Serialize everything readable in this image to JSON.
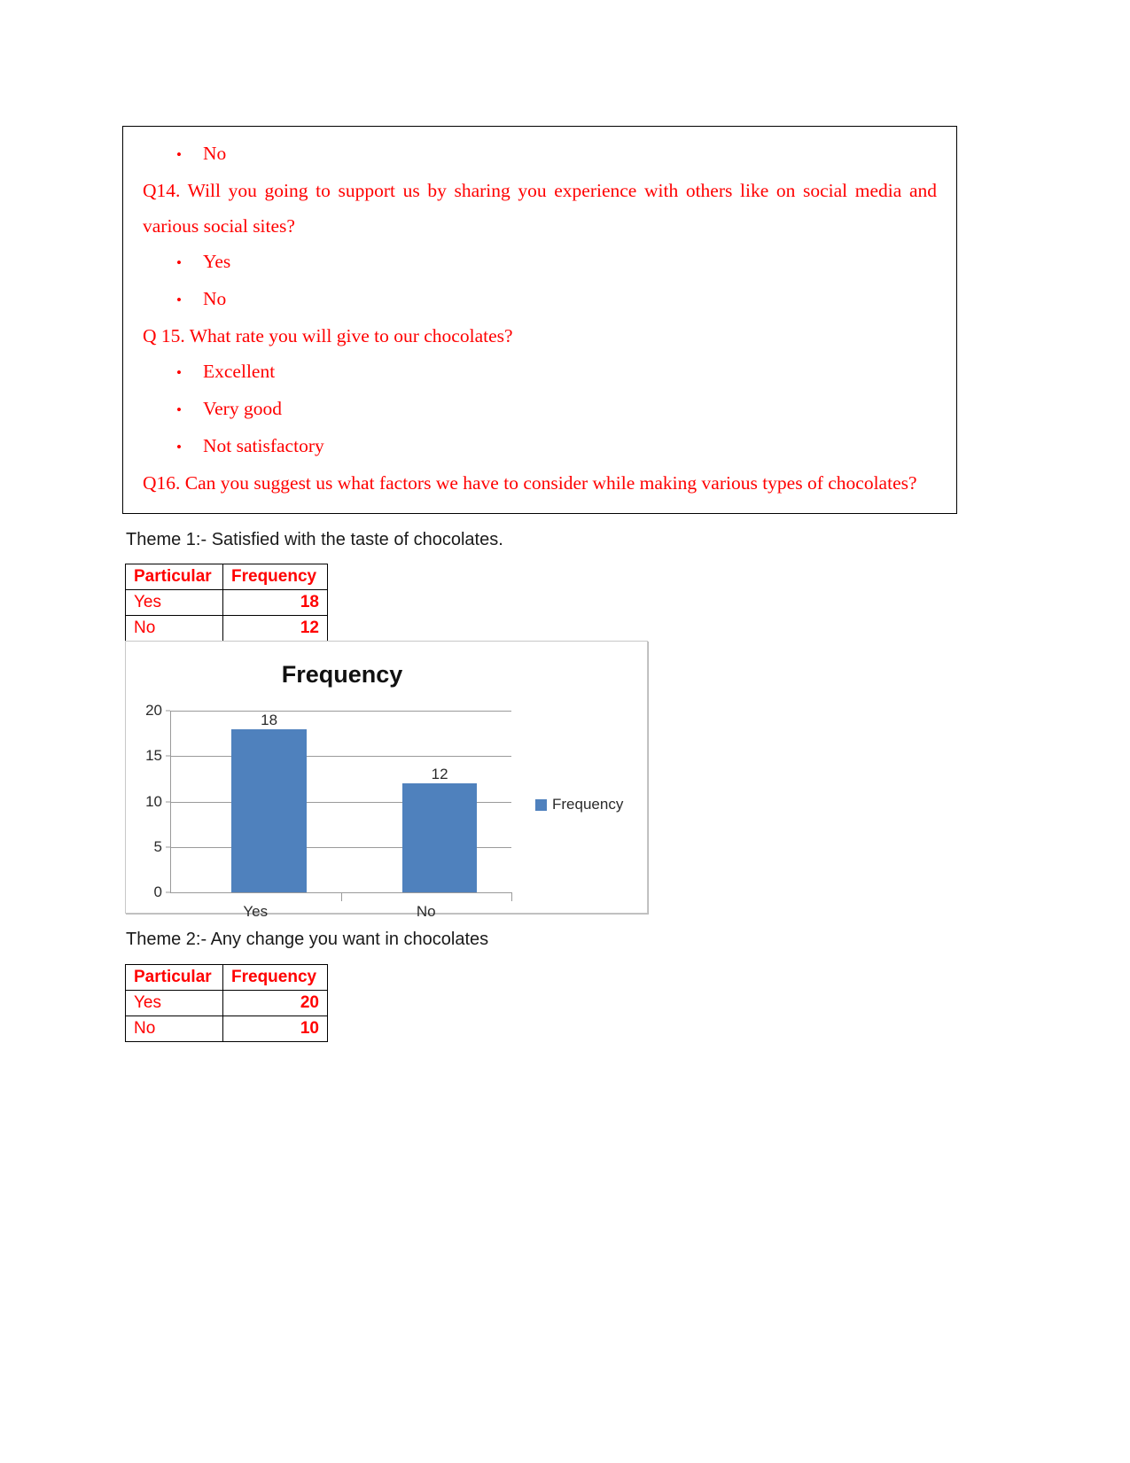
{
  "questionnaire": {
    "pre_bullet": {
      "label": "No",
      "marker": "•"
    },
    "q14": {
      "text": "Q14. Will you going to support us by sharing you experience with others like on social media and various social sites?",
      "options": [
        {
          "marker": "•",
          "label": "Yes"
        },
        {
          "marker": "•",
          "label": "No"
        }
      ]
    },
    "q15": {
      "text": "Q 15. What rate you will give to our chocolates?",
      "options": [
        {
          "marker": "•",
          "label": "Excellent"
        },
        {
          "marker": "•",
          "label": "Very good"
        },
        {
          "marker": "•",
          "label": "Not satisfactory"
        }
      ]
    },
    "q16": {
      "text": "Q16. Can you suggest us what factors we have to consider while making various types of chocolates?"
    }
  },
  "theme1": {
    "heading": "Theme 1:- Satisfied with the taste of chocolates.",
    "table": {
      "headers": [
        "Particular",
        "Frequency"
      ],
      "rows": [
        {
          "particular": "Yes",
          "frequency": "18"
        },
        {
          "particular": "No",
          "frequency": "12"
        }
      ]
    }
  },
  "theme2": {
    "heading": "Theme 2:- Any change you want in chocolates",
    "table": {
      "headers": [
        "Particular",
        "Frequency"
      ],
      "rows": [
        {
          "particular": "Yes",
          "frequency": "20"
        },
        {
          "particular": "No",
          "frequency": "10"
        }
      ]
    }
  },
  "chart_data": {
    "type": "bar",
    "title": "Frequency",
    "categories": [
      "Yes",
      "No"
    ],
    "values": [
      18,
      12
    ],
    "data_labels": [
      "18",
      "12"
    ],
    "series": [
      {
        "name": "Frequency",
        "values": [
          18,
          12
        ]
      }
    ],
    "xlabel": "",
    "ylabel": "",
    "ylim": [
      0,
      20
    ],
    "yticks": [
      "0",
      "5",
      "10",
      "15",
      "20"
    ],
    "ytick_values": [
      0,
      5,
      10,
      15,
      20
    ],
    "grid": true,
    "legend": {
      "position": "right",
      "entries": [
        "Frequency"
      ]
    },
    "colors": {
      "series": "#4F81BD"
    }
  }
}
